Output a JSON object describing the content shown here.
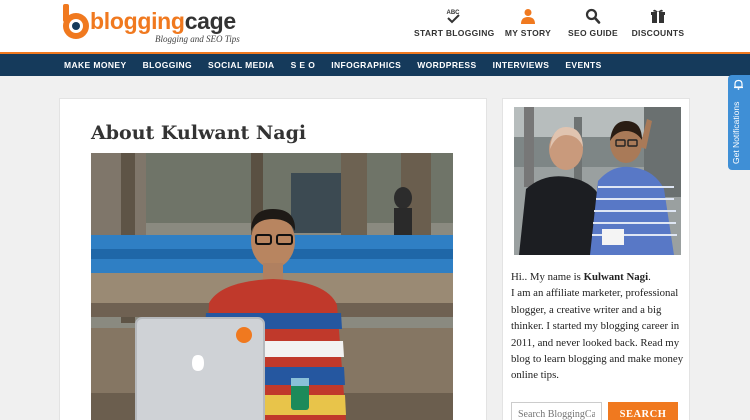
{
  "brand": {
    "name_part1": "blogging",
    "name_part2": "cage",
    "tagline": "Blogging and SEO Tips",
    "colors": {
      "orange": "#f0791f",
      "navy": "#153a5b",
      "notification_blue": "#3f8fd6"
    }
  },
  "top_nav": [
    {
      "label": "START BLOGGING",
      "icon": "abc-check-icon"
    },
    {
      "label": "MY STORY",
      "icon": "user-icon"
    },
    {
      "label": "SEO GUIDE",
      "icon": "search-icon"
    },
    {
      "label": "DISCOUNTS",
      "icon": "gift-icon"
    }
  ],
  "main_menu": [
    "MAKE MONEY",
    "BLOGGING",
    "SOCIAL MEDIA",
    "S E O",
    "INFOGRAPHICS",
    "WORDPRESS",
    "INTERVIEWS",
    "EVENTS"
  ],
  "content": {
    "title": "About Kulwant Nagi"
  },
  "sidebar": {
    "bio_intro": "Hi.. My name is ",
    "bio_name": "Kulwant Nagi",
    "bio_end": ".",
    "bio_rest": "I am an affiliate marketer, professional blogger, a creative writer and a big thinker. I started my blogging career in 2011, and never looked back. Read my blog to learn blogging and make money online tips.",
    "search_placeholder": "Search BloggingCage",
    "search_button": "SEARCH"
  },
  "notification_tab": {
    "label": "Get Notifications",
    "icon": "bell-icon"
  }
}
